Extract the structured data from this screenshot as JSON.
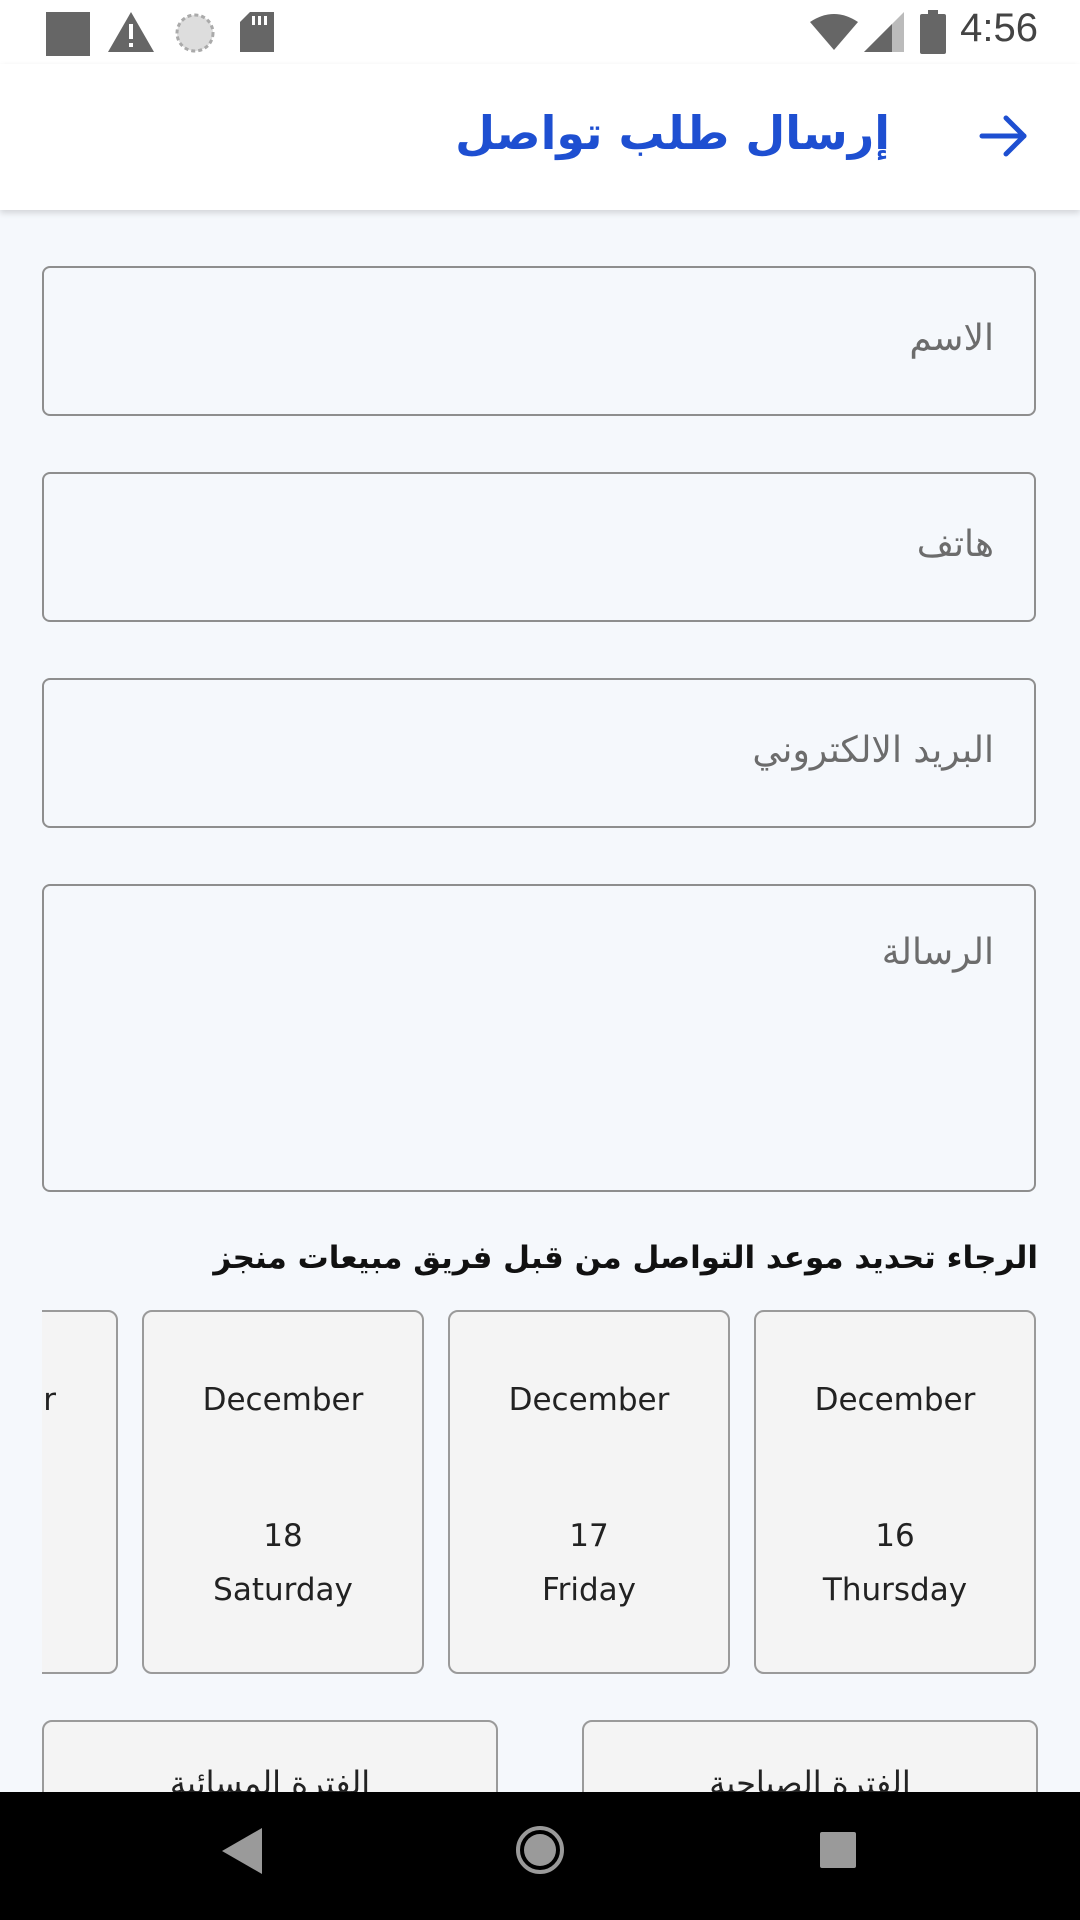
{
  "status_bar": {
    "time": "4:56",
    "left_icons": [
      "square-notification-icon",
      "warning-icon",
      "sync-icon",
      "sd-card-icon"
    ],
    "right_icons": [
      "wifi-icon",
      "cell-signal-icon",
      "battery-icon"
    ]
  },
  "app_bar": {
    "title": "إرسال طلب تواصل",
    "back_icon": "arrow-forward-icon",
    "accent_color": "#1e4fd1"
  },
  "form": {
    "name_placeholder": "الاسم",
    "phone_placeholder": "هاتف",
    "email_placeholder": "البريد الالكتروني",
    "message_placeholder": "الرسالة"
  },
  "schedule": {
    "prompt": "الرجاء تحديد موعد التواصل من قبل فريق مبيعات منجز",
    "dates": [
      {
        "month": "December",
        "day": "16",
        "weekday": "Thursday"
      },
      {
        "month": "December",
        "day": "17",
        "weekday": "Friday"
      },
      {
        "month": "December",
        "day": "18",
        "weekday": "Saturday"
      },
      {
        "month": "er",
        "day": "",
        "weekday": ""
      }
    ],
    "periods": [
      "الفترة الصباحية",
      "الفترة المسائية"
    ]
  },
  "nav_bar": {
    "buttons": [
      "back-triangle-icon",
      "home-circle-icon",
      "recents-square-icon"
    ]
  }
}
